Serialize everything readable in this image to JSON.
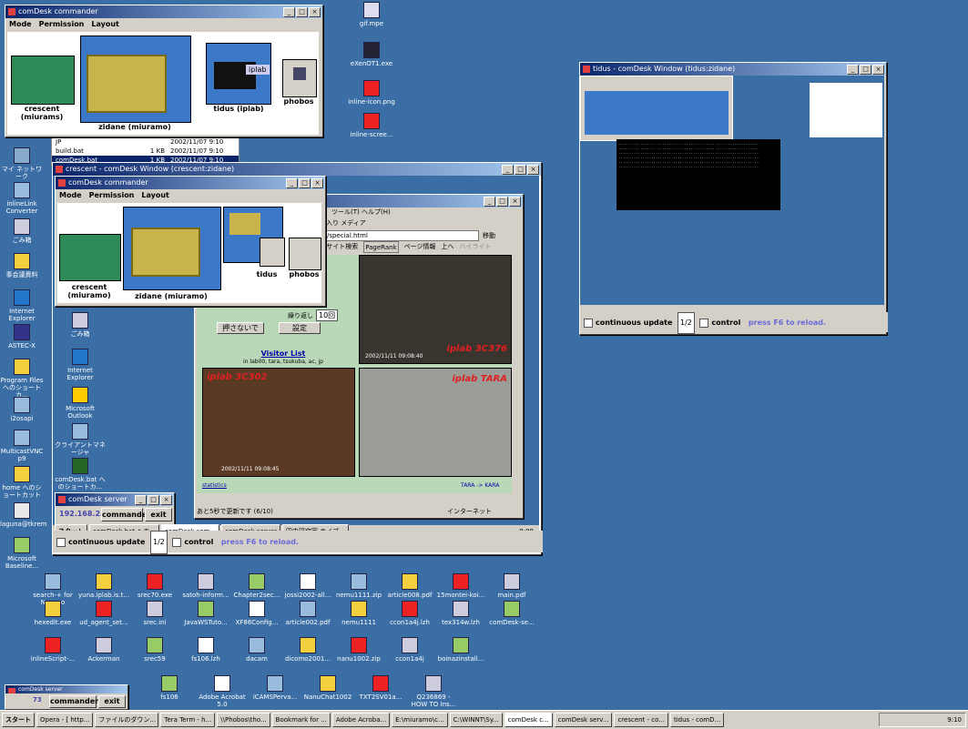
{
  "win_topleft": {
    "title": "comDesk commander",
    "menu": [
      "Mode",
      "Permission",
      "Layout"
    ],
    "labels": {
      "left": "crescent (miurams)",
      "center": "zidane (miuramo)",
      "right": "tidus (iplab)",
      "far": "phobos",
      "tag": "iplab"
    }
  },
  "win_main": {
    "title": "crescent - comDesk Window (crescent:zidane)",
    "inner_title": "comDesk commander",
    "menu": [
      "Mode",
      "Permission",
      "Layout"
    ],
    "labels": {
      "left": "crescent (miuramo)",
      "center": "zidane (miuramo)",
      "right": "tidus",
      "far": "phobos"
    },
    "browser": {
      "address": "a/live/special.html",
      "menu_frag": "ツール(T)  ヘルプ(H)",
      "toolbar_frag": "気に入り  メディア",
      "search_frag": "検索  サイト検索",
      "pagerank": "PageRank",
      "pageinfo": "ページ情報",
      "up": "上へ",
      "highlight": "ハイライト",
      "go": "移動",
      "repeat": "繰り返し",
      "repeat_val": "10回",
      "btn_nopush": "押さないで",
      "btn_set": "設定",
      "visitor_title": "Visitor List",
      "visitor_body": "in lab00, tara, tsukuba, ac, jp",
      "cam1_label": "iplab 3C376",
      "cam1_time": "2002/11/11 09:08:40",
      "cam2_label": "iplab 3C302",
      "cam2_time": "2002/11/11 09:08:45",
      "cam3_label": "iplab TARA",
      "link": "statistics",
      "link2": "TARA -> KARA",
      "status": "あと5秒で更新です (6/10)",
      "zone": "インターネット"
    },
    "taskbar": [
      "スタート",
      "comDesk.bat への...",
      "comDesk com...",
      "comDesk server",
      "田中研究室 ライブ..."
    ],
    "clock": "9:09",
    "bottom": {
      "check1": "continuous update",
      "select": "1/2",
      "check2": "control",
      "hint": "press F6 to reload."
    }
  },
  "win_right": {
    "title": "tidus - comDesk Window (tidus:zidane)",
    "bottom": {
      "check1": "continuous update",
      "select": "1/2",
      "check2": "control",
      "hint": "press F6 to reload."
    }
  },
  "win_server_inner": {
    "title": "comDesk server",
    "ip": "192.168.2.27",
    "btn1": "commander",
    "btn2": "exit"
  },
  "win_server_bottom": {
    "title": "comDesk server",
    "ip": "73",
    "btn1": "commander",
    "btn2": "exit"
  },
  "file_list": [
    {
      "name": "JP",
      "size": "",
      "date": "2002/11/07 9:10"
    },
    {
      "name": "build.bat",
      "size": "1 KB",
      "date": "2002/11/07 9:10"
    },
    {
      "name": "comDesk.bat",
      "size": "1 KB",
      "date": "2002/11/07 9:10"
    }
  ],
  "icons_left": [
    "マイ ネットワーク",
    "inlineLink Converter",
    "ごみ箱",
    "事会議資料",
    "Internet Explorer",
    "ASTEC-X",
    "Program Files へのショートカ...",
    "i2osapi",
    "MulticastVNC p9",
    "home へのショートカット",
    "laguna@tkrem",
    "Microsoft Baseline...",
    "search-+ for Nanaco",
    "hexedit.exe"
  ],
  "icons_top": [
    "gif.mpe",
    "eXenOT1.exe",
    "inline-icon.png",
    "inline-scree..."
  ],
  "icons_inner": [
    "ごみ箱",
    "Internet Explorer",
    "Microsoft Outlook",
    "クライアントマネージャ",
    "comDesk.bat へのショートカ..."
  ],
  "icons_bottom_rows": [
    [
      "search-+ for Nanaco",
      "yuna.iplab.is.t...",
      "srec70.exe",
      "satoh-inform...",
      "Chapter2sec...",
      "jossi2002-all...",
      "nemu1111.zip",
      "article008.pdf",
      "15montei-koi...",
      "main.pdf"
    ],
    [
      "hexedit.exe",
      "ud_agent_set...",
      "srec.ini",
      "JavaWSTuto...",
      "XF86Config...",
      "article002.pdf",
      "nemu1111",
      "ccon1a4j.lzh",
      "tex314w.lzh",
      "comDesk-se..."
    ],
    [
      "inlineScript-...",
      "Ackerman",
      "srec59",
      "fs106.lzh",
      "dacam",
      "dicomo2001...",
      "nanu1002.zip",
      "ccon1a4j",
      "boinazinstall..."
    ],
    [
      "",
      "fs106",
      "Adobe Acrobat 5.0",
      "iCAMSPerva...",
      "NanuChat1002",
      "TXT2SV01a...",
      "Q236869 - HOW TO Ins..."
    ]
  ],
  "taskbar": {
    "start": "スタート",
    "items": [
      "Opera - [ http...",
      "ファイルのダウン...",
      "Tera Term - h...",
      "\\\\Phobos\\tho...",
      "Bookmark for ...",
      "Adobe Acroba...",
      "E:\\miuramo\\c...",
      "C:\\WINNT\\Sy...",
      "comDesk c...",
      "comDesk serv...",
      "crescent - co...",
      "tidus - comD..."
    ],
    "clock": "9:10"
  },
  "colors": {
    "desktop": "#3a6ea5",
    "titlebar": "#0a246a",
    "window": "#d4d0c8",
    "accent_red": "#e02020"
  }
}
